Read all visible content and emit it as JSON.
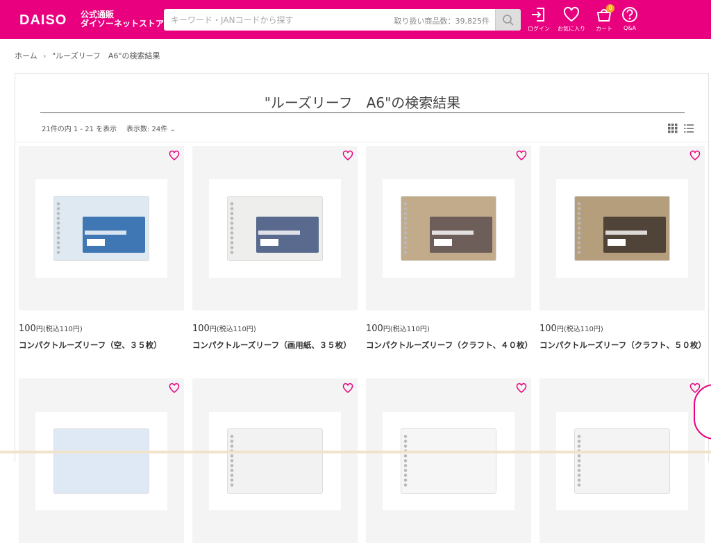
{
  "header": {
    "logo_text": "DAISO",
    "logo_sub_1": "公式通販",
    "logo_sub_2": "ダイソーネットストア",
    "search_placeholder": "キーワード・JANコードから探す",
    "search_count": "取り扱い商品数：39,825件",
    "login_label": "ログイン",
    "favorites_label": "お気に入り",
    "cart_label": "カート",
    "cart_count": "0",
    "qa_label": "Q&A"
  },
  "breadcrumb": {
    "home": "ホーム",
    "separator": "›",
    "current": "\"ルーズリーフ　A6\"の検索結果"
  },
  "results": {
    "title": "\"ルーズリーフ　A6\"の検索結果",
    "count_text": "21件の内 1 - 21 を表示",
    "per_page_label": "表示数: 24件",
    "per_page_chevron": "⌄"
  },
  "products": [
    {
      "price": "100",
      "yen": "円",
      "tax": "(税込110円)",
      "name": "コンパクトルーズリーフ（空、３５枚）",
      "pkg_color": "#dfe9f2",
      "label_color": "#3f77b4"
    },
    {
      "price": "100",
      "yen": "円",
      "tax": "(税込110円)",
      "name": "コンパクトルーズリーフ（画用紙、３５枚）",
      "pkg_color": "#eeeeec",
      "label_color": "#5a6a8e"
    },
    {
      "price": "100",
      "yen": "円",
      "tax": "(税込110円)",
      "name": "コンパクトルーズリーフ（クラフト、４０枚）",
      "pkg_color": "#c1ab8a",
      "label_color": "#6d5e5a"
    },
    {
      "price": "100",
      "yen": "円",
      "tax": "(税込110円)",
      "name": "コンパクトルーズリーフ（クラフト、５０枚）",
      "pkg_color": "#b59e7c",
      "label_color": "#4f4437"
    }
  ],
  "colors": {
    "brand": "#e8007f",
    "heart": "#e8007f"
  }
}
